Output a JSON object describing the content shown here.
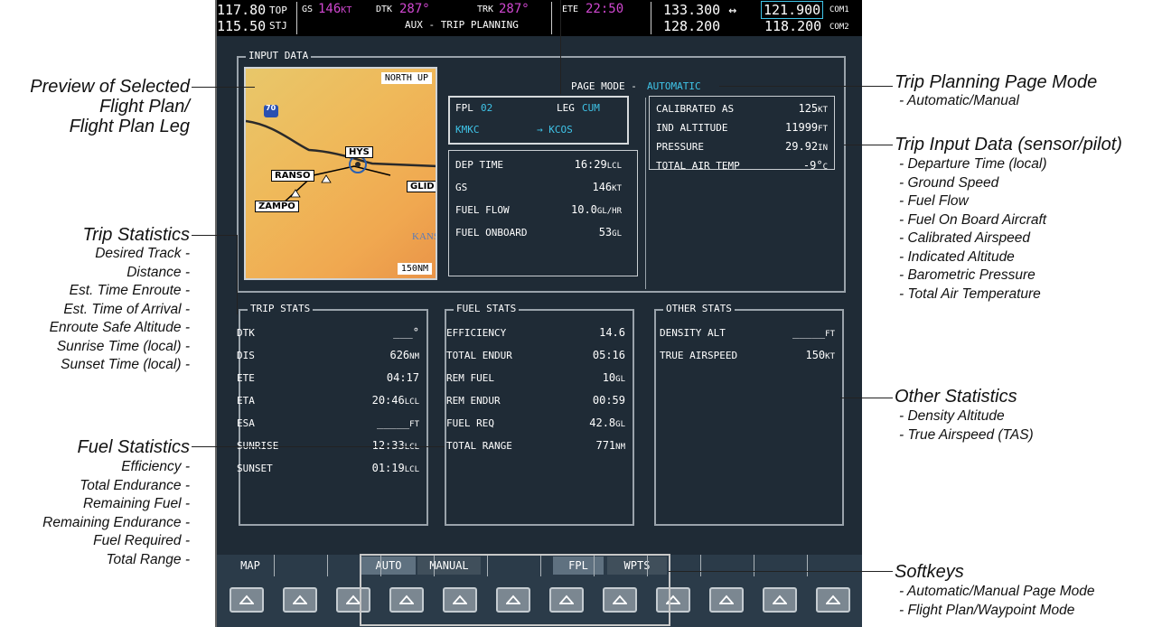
{
  "navbar": {
    "freq_active1": "117.80",
    "freq_standby1": "115.50",
    "top_label": "TOP",
    "stj_label": "STJ",
    "gs_label": "GS",
    "gs_value": "146",
    "gs_unit": "KT",
    "dtk_label": "DTK",
    "dtk_value": "287°",
    "trk_label": "TRK",
    "trk_value": "287°",
    "ete_label": "ETE",
    "ete_value": "22:50",
    "page_title": "AUX - TRIP PLANNING",
    "com_active1": "133.300 ↔",
    "com_standby1": "121.900",
    "com1_label": "COM1",
    "com_active2": "128.200",
    "com_standby2": "118.200",
    "com2_label": "COM2"
  },
  "input_data": {
    "label": "INPUT DATA",
    "map_orientation": "NORTH UP",
    "map_range": "150NM",
    "map_labels": [
      "RANSO",
      "HYS",
      "GLID",
      "ZAMPO",
      "KANS"
    ],
    "highway": "70",
    "page_mode_label": "PAGE MODE -",
    "page_mode_value": "AUTOMATIC",
    "fpl_label": "FPL",
    "fpl_value": "02",
    "leg_label": "LEG",
    "leg_value": "CUM",
    "from_wpt": "KMKC",
    "to_wpt": "→ KCOS",
    "left_rows": [
      {
        "label": "DEP TIME",
        "value": "16:29",
        "unit": "LCL"
      },
      {
        "label": "GS",
        "value": "146",
        "unit": "KT"
      },
      {
        "label": "FUEL FLOW",
        "value": "10.0",
        "unit": "GL/HR"
      },
      {
        "label": "FUEL ONBOARD",
        "value": "53",
        "unit": "GL"
      }
    ],
    "right_rows": [
      {
        "label": "CALIBRATED AS",
        "value": "125",
        "unit": "KT"
      },
      {
        "label": "IND ALTITUDE",
        "value": "11999",
        "unit": "FT"
      },
      {
        "label": "PRESSURE",
        "value": "29.92",
        "unit": "IN"
      },
      {
        "label": "TOTAL AIR TEMP",
        "value": "-9°",
        "unit": "C"
      }
    ]
  },
  "trip_stats": {
    "label": "TRIP STATS",
    "rows": [
      {
        "label": "DTK",
        "value": "___°",
        "unit": ""
      },
      {
        "label": "DIS",
        "value": "626",
        "unit": "NM"
      },
      {
        "label": "ETE",
        "value": "04:17",
        "unit": ""
      },
      {
        "label": "ETA",
        "value": "20:46",
        "unit": "LCL"
      },
      {
        "label": "ESA",
        "value": "_____",
        "unit": "FT"
      },
      {
        "label": "SUNRISE",
        "value": "12:33",
        "unit": "LCL"
      },
      {
        "label": "SUNSET",
        "value": "01:19",
        "unit": "LCL"
      }
    ]
  },
  "fuel_stats": {
    "label": "FUEL STATS",
    "rows": [
      {
        "label": "EFFICIENCY",
        "value": "14.6",
        "unit": ""
      },
      {
        "label": "TOTAL ENDUR",
        "value": "05:16",
        "unit": ""
      },
      {
        "label": "REM FUEL",
        "value": "10",
        "unit": "GL"
      },
      {
        "label": "REM ENDUR",
        "value": "00:59",
        "unit": ""
      },
      {
        "label": "FUEL REQ",
        "value": "42.8",
        "unit": "GL"
      },
      {
        "label": "TOTAL RANGE",
        "value": "771",
        "unit": "NM"
      }
    ]
  },
  "other_stats": {
    "label": "OTHER STATS",
    "rows": [
      {
        "label": "DENSITY ALT",
        "value": "_____",
        "unit": "FT"
      },
      {
        "label": "TRUE AIRSPEED",
        "value": "150",
        "unit": "KT"
      }
    ]
  },
  "softkeys": {
    "map": "MAP",
    "auto": "AUTO",
    "manual": "MANUAL",
    "fpl": "FPL",
    "wpts": "WPTS"
  },
  "annotations": {
    "preview_title": "Preview of Selected Flight Plan/ Flight Plan Leg",
    "preview_line1": "Preview of Selected",
    "preview_line2": "Flight Plan/",
    "preview_line3": "Flight Plan Leg",
    "trip_stats_title": "Trip Statistics",
    "trip_stats_items": [
      "Desired Track -",
      "Distance -",
      "Est. Time Enroute -",
      "Est. Time of Arrival -",
      "Enroute Safe Altitude -",
      "Sunrise Time (local) -",
      "Sunset Time (local) -"
    ],
    "fuel_stats_title": "Fuel Statistics",
    "fuel_stats_items": [
      "Efficiency -",
      "Total Endurance -",
      "Remaining Fuel -",
      "Remaining Endurance -",
      "Fuel Required -",
      "Total Range -"
    ],
    "page_mode_title": "Trip Planning Page Mode",
    "page_mode_items": [
      "- Automatic/Manual"
    ],
    "input_title": "Trip Input Data (sensor/pilot)",
    "input_items": [
      "- Departure Time (local)",
      "- Ground Speed",
      "- Fuel Flow",
      "- Fuel On Board Aircraft",
      "- Calibrated Airspeed",
      "- Indicated Altitude",
      "- Barometric Pressure",
      "- Total Air Temperature"
    ],
    "other_title": "Other Statistics",
    "other_items": [
      "- Density Altitude",
      "- True Airspeed (TAS)"
    ],
    "softkeys_title": "Softkeys",
    "softkeys_items": [
      "- Automatic/Manual Page Mode",
      "- Flight Plan/Waypoint Mode"
    ]
  }
}
